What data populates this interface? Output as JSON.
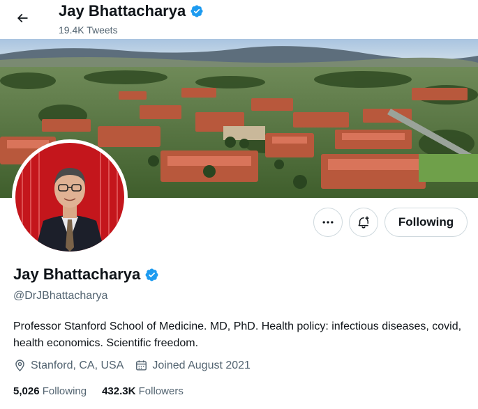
{
  "header": {
    "name": "Jay Bhattacharya",
    "tweet_count": "19.4K Tweets",
    "back_icon": "arrow-left-icon"
  },
  "profile": {
    "name": "Jay Bhattacharya",
    "verified": true,
    "handle": "@DrJBhattacharya",
    "bio": "Professor Stanford School of Medicine.  MD, PhD.  Health policy: infectious diseases, covid, health economics. Scientific freedom.",
    "location": "Stanford, CA, USA",
    "joined": "Joined August 2021",
    "following_count": "5,026",
    "following_label": "Following",
    "followers_count": "432.3K",
    "followers_label": "Followers"
  },
  "actions": {
    "more_icon": "more-horizontal-icon",
    "notify_icon": "bell-plus-icon",
    "following_button": "Following"
  },
  "colors": {
    "verified_blue": "#1d9bf0",
    "text_primary": "#0f1419",
    "text_secondary": "#536471",
    "border": "#cfd9de"
  }
}
